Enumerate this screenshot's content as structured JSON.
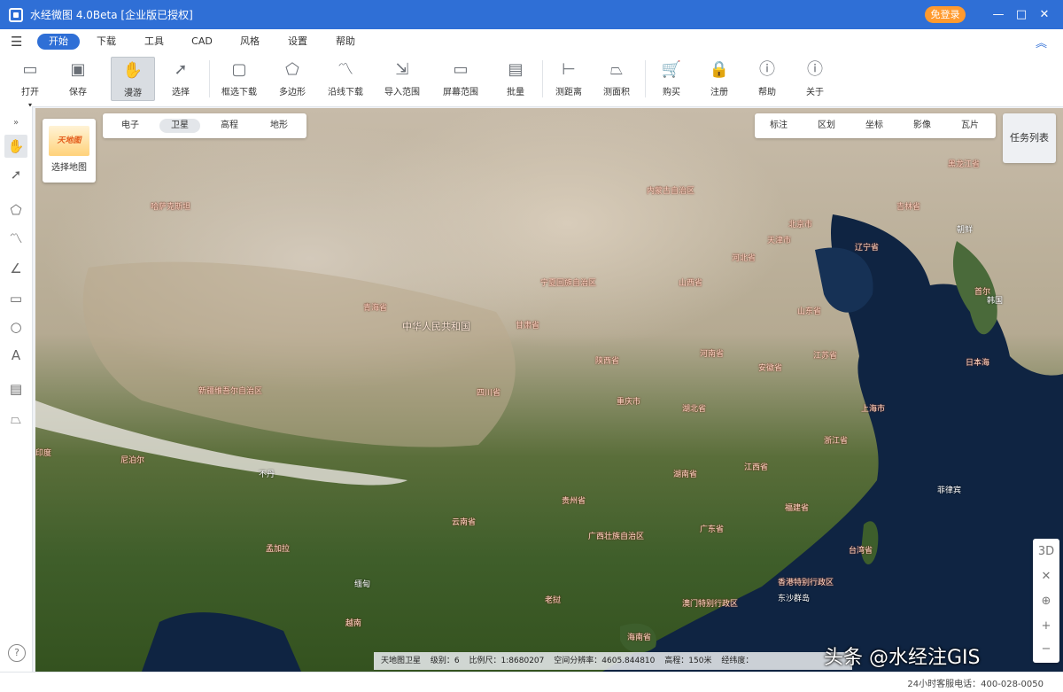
{
  "titlebar": {
    "title": "水经微图 4.0Beta [企业版已授权]",
    "login": "免登录",
    "minimize": "—",
    "maximize": "□",
    "close": "✕"
  },
  "menu": {
    "items": [
      "开始",
      "下载",
      "工具",
      "CAD",
      "风格",
      "设置",
      "帮助"
    ]
  },
  "ribbon": {
    "open": "打开",
    "save": "保存",
    "pan": "漫游",
    "select": "选择",
    "box_download": "框选下载",
    "polygon": "多边形",
    "polyline_download": "沿线下载",
    "import_range": "导入范围",
    "screen_range": "屏幕范围",
    "batch": "批量",
    "measure_distance": "测距离",
    "measure_area": "测面积",
    "buy": "购买",
    "register": "注册",
    "help": "帮助",
    "about": "关于"
  },
  "map": {
    "logo_text": "天地图",
    "select_map": "选择地图",
    "types": [
      "电子",
      "卫星",
      "高程",
      "地形"
    ],
    "tools": [
      "标注",
      "区划",
      "坐标",
      "影像",
      "瓦片"
    ],
    "task_list": "任务列表",
    "controls": [
      "3D",
      "✕",
      "⊕",
      "+",
      "−"
    ],
    "places": {
      "kazakh": "哈萨克斯坦",
      "xinjiang": "新疆维吾尔自治区",
      "neimenggu": "内蒙古自治区",
      "heilongjiang": "黑龙江省",
      "jilin": "吉林省",
      "liaoning": "辽宁省",
      "beijing": "北京市",
      "tianjin": "天津市",
      "hebei": "河北省",
      "shanxi": "山西省",
      "shandong": "山东省",
      "ningxia": "宁夏回族自治区",
      "gansu": "甘肃省",
      "qinghai": "青海省",
      "prc": "中华人民共和国",
      "shaanxi": "陕西省",
      "henan": "河南省",
      "jiangsu": "江苏省",
      "anhui": "安徽省",
      "shanghai": "上海市",
      "hubei": "湖北省",
      "chongqing": "重庆市",
      "sichuan": "四川省",
      "zhejiang": "浙江省",
      "xizang": "西藏自治区",
      "hunan": "湖南省",
      "jiangxi": "江西省",
      "guizhou": "贵州省",
      "fujian": "福建省",
      "yunnan": "云南省",
      "guangxi": "广西壮族自治区",
      "guangdong": "广东省",
      "taiwan": "台湾省",
      "hongkong": "香港特别行政区",
      "macau": "澳门特别行政区",
      "hainan": "海南省",
      "korea_n": "朝鲜",
      "korea_s": "韩国",
      "seoul": "首尔",
      "nepal": "尼泊尔",
      "bhutan": "不丹",
      "bangladesh": "孟加拉",
      "myanmar": "缅甸",
      "laos": "老挝",
      "vietnam": "越南",
      "dongsha": "东沙群岛",
      "philippines": "菲律宾",
      "india": "印度",
      "japan": "日本海"
    }
  },
  "status": {
    "source": "天地图卫星",
    "level_label": "级别：",
    "level": "6",
    "scale_label": "比例尺：",
    "scale": "1:8680207",
    "resolution_label": "空间分辨率：",
    "resolution": "4605.844810",
    "elev_label": "高程：",
    "elev": "150米",
    "coord_label": "经纬度："
  },
  "watermark": "头条 @水经注GIS",
  "footer": {
    "help_icon": "?",
    "hotline": "24小时客服电话：400-028-0050"
  }
}
